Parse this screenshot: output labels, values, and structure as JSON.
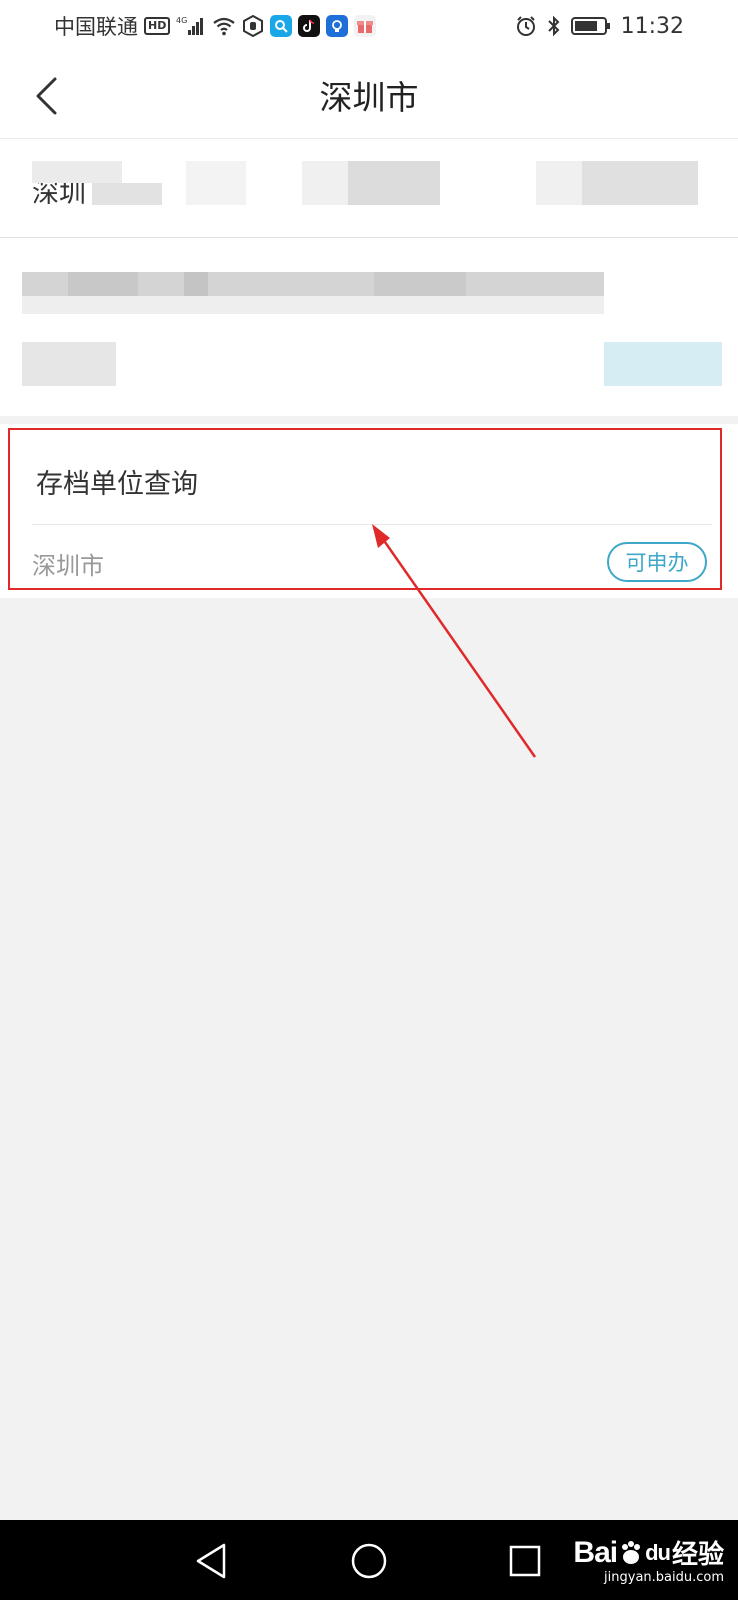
{
  "status_bar": {
    "carrier": "中国联通",
    "hd_badge": "HD",
    "network": "4G",
    "time": "11:32",
    "icons": [
      "hd-icon",
      "signal-icon",
      "wifi-icon",
      "hand-icon",
      "search-app-icon",
      "tiktok-icon",
      "bulb-app-icon",
      "gift-app-icon",
      "alarm-icon",
      "bluetooth-icon",
      "battery-icon"
    ]
  },
  "header": {
    "title": "深圳市",
    "back_icon": "chevron-left-icon"
  },
  "blurred": {
    "row1_label": "深圳"
  },
  "card": {
    "title": "存档单位查询",
    "city": "深圳市",
    "badge": "可申办",
    "accent_color": "#3fa7c8",
    "highlight_color": "#e02a2a"
  },
  "nav_bar": {
    "icons": [
      "back-triangle-icon",
      "home-circle-icon",
      "recents-square-icon"
    ]
  },
  "watermark": {
    "logo": "Bai",
    "logo_tail": "du",
    "jingyan": "经验",
    "url": "jingyan.baidu.com"
  }
}
